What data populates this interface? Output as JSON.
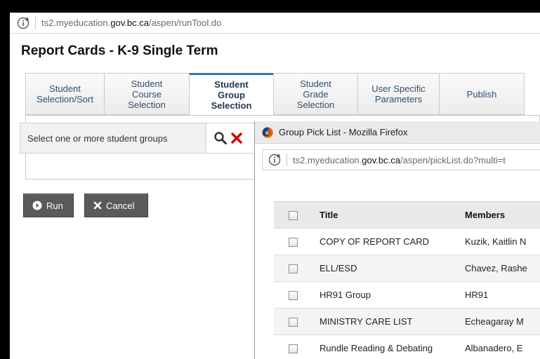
{
  "main_window": {
    "url": {
      "prefix": "ts2.myeducation.",
      "domain": "gov.bc.ca",
      "path": "/aspen/runTool.do"
    },
    "page_title": "Report Cards - K-9 Single Term",
    "tabs": [
      {
        "label": "Student\nSelection/Sort",
        "active": false
      },
      {
        "label": "Student\nCourse\nSelection",
        "active": false
      },
      {
        "label": "Student\nGroup\nSelection",
        "active": true
      },
      {
        "label": "Student\nGrade\nSelection",
        "active": false
      },
      {
        "label": "User Specific\nParameters",
        "active": false
      },
      {
        "label": "Publish",
        "active": false
      }
    ],
    "select_prompt": "Select one or more student groups",
    "run_label": "Run",
    "cancel_label": "Cancel",
    "accent_color": "#2a7ab8",
    "clear_color": "#d40000"
  },
  "popup": {
    "title": "Group Pick List - Mozilla Firefox",
    "url": {
      "prefix": "ts2.myeducation.",
      "domain": "gov.bc.ca",
      "path": "/aspen/pickList.do?multi=t"
    },
    "columns": {
      "title": "Title",
      "members": "Members"
    },
    "rows": [
      {
        "title": "COPY OF REPORT CARD",
        "members": "Kuzik, Kaitlin N"
      },
      {
        "title": "ELL/ESD",
        "members": "Chavez, Rashe"
      },
      {
        "title": "HR91 Group",
        "members": "HR91"
      },
      {
        "title": "MINISTRY CARE LIST",
        "members": "Echeagaray M"
      },
      {
        "title": "Rundle Reading & Debating",
        "members": "Albanadero, E"
      }
    ]
  }
}
